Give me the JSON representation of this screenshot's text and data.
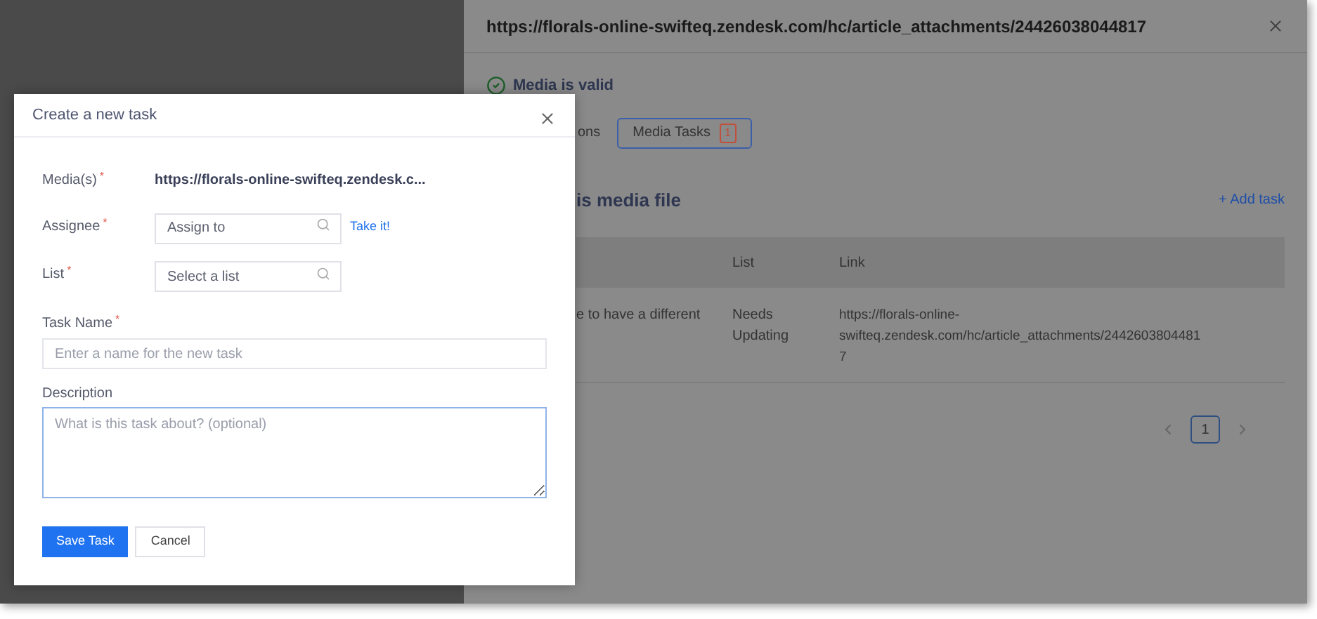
{
  "panel": {
    "title": "https://florals-online-swifteq.zendesk.com/hc/article_attachments/24426038044817",
    "status": "Media is valid",
    "tabs": [
      {
        "label": "ons",
        "selected": false
      },
      {
        "label": "Media Tasks",
        "badge": "1",
        "selected": true
      }
    ],
    "heading": "is media file",
    "add_button": "+ Add task",
    "table": {
      "columns": [
        "",
        "List",
        "Link"
      ],
      "rows": [
        {
          "cells": [
            "e to have a different",
            "Needs Updating",
            "https://florals-online-swifteq.zendesk.com/hc/article_attachments/24426038044817"
          ]
        }
      ]
    },
    "pagination": {
      "pages": [
        {
          "label": "1",
          "selected": true
        }
      ]
    }
  },
  "dialog": {
    "title": "Create a new task",
    "required_mark": "*",
    "media": {
      "label": "Media(s)",
      "value": "https://florals-online-swifteq.zendesk.c..."
    },
    "assignee": {
      "label": "Assignee",
      "placeholder": "Assign to",
      "link": "Take it!"
    },
    "list": {
      "label": "List",
      "placeholder": "Select a list"
    },
    "task_name": {
      "label": "Task Name",
      "placeholder": "Enter a name for the new task"
    },
    "description": {
      "label": "Description",
      "placeholder": "What is this task about? (optional)"
    },
    "buttons": [
      "Save Task",
      "Cancel"
    ]
  }
}
